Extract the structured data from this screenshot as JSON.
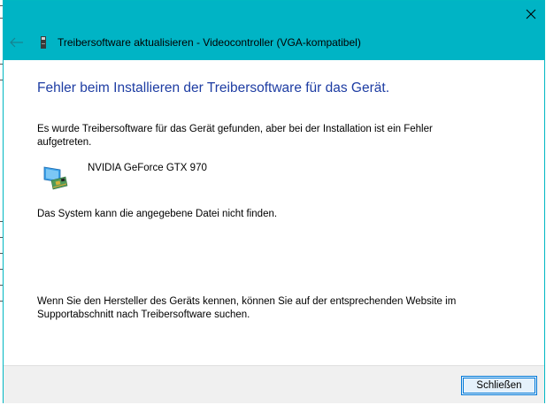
{
  "window": {
    "title": "Treibersoftware aktualisieren - Videocontroller (VGA-kompatibel)",
    "accent_color": "#00b4c5"
  },
  "icons": {
    "close": "close-icon",
    "back": "back-arrow-icon",
    "device": "display-adapter-icon"
  },
  "content": {
    "heading": "Fehler beim Installieren der Treibersoftware für das Gerät.",
    "intro": "Es wurde Treibersoftware für das Gerät gefunden, aber bei der Installation ist ein Fehler aufgetreten.",
    "device_name": "NVIDIA GeForce GTX 970",
    "error_message": "Das System kann die angegebene Datei nicht finden.",
    "hint": "Wenn Sie den Hersteller des Geräts kennen, können Sie auf der entsprechenden Website im Supportabschnitt nach Treibersoftware suchen."
  },
  "footer": {
    "close_label": "Schließen"
  }
}
